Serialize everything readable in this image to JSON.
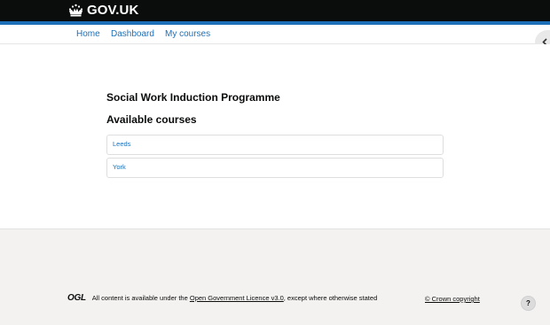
{
  "header": {
    "logo_text": "GOV.UK",
    "logo_icon": "crown-icon",
    "bg_color": "#0b0c0c",
    "accent_color": "#1d70b8"
  },
  "nav": {
    "items": [
      {
        "label": "Home"
      },
      {
        "label": "Dashboard"
      },
      {
        "label": "My courses"
      }
    ]
  },
  "drawer_toggle": {
    "icon": "chevron-left-icon"
  },
  "main": {
    "programme_title": "Social Work Induction Programme",
    "courses_heading": "Available courses",
    "courses": [
      {
        "name": "Leeds"
      },
      {
        "name": "York"
      }
    ]
  },
  "footer": {
    "ogl_logo": "OGL",
    "licence_prefix": "All content is available under the",
    "licence_link": "Open Government Licence v3.0",
    "licence_suffix": ", except where otherwise stated",
    "copyright": "© Crown copyright",
    "help_label": "?"
  }
}
